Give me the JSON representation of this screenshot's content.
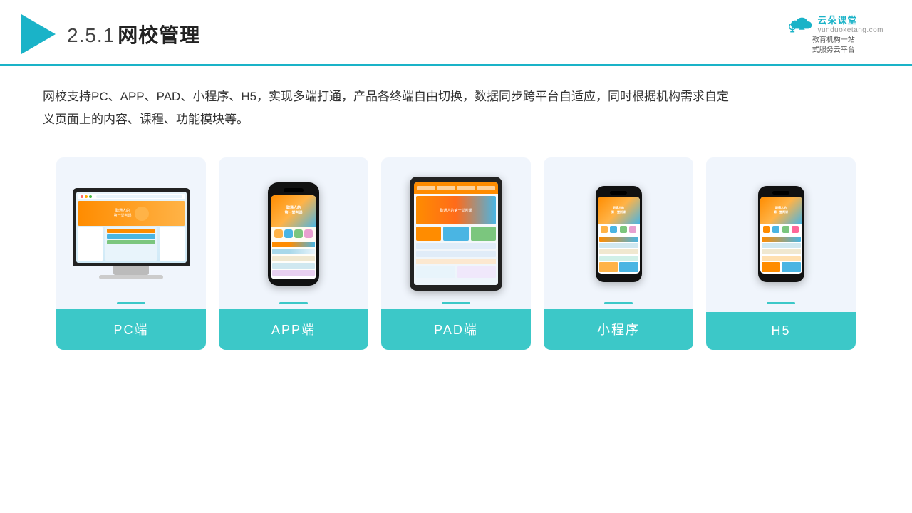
{
  "header": {
    "section": "2.5.1",
    "title": "网校管理",
    "brand": {
      "name_cn": "云朵课堂",
      "url": "yunduoketang.com",
      "slogan_line1": "教育机构一站",
      "slogan_line2": "式服务云平台"
    }
  },
  "description": {
    "text": "网校支持PC、APP、PAD、小程序、H5，实现多端打通，产品各终端自由切换，数据同步跨平台自适应，同时根据机构需求自定义页面上的内容、课程、功能模块等。"
  },
  "cards": [
    {
      "id": "pc",
      "label": "PC端"
    },
    {
      "id": "app",
      "label": "APP端"
    },
    {
      "id": "pad",
      "label": "PAD端"
    },
    {
      "id": "miniprogram",
      "label": "小程序"
    },
    {
      "id": "h5",
      "label": "H5"
    }
  ],
  "colors": {
    "accent": "#1ab3c8",
    "teal": "#3cc8c8",
    "card_bg": "#f0f5fc",
    "orange": "#ff8c00"
  }
}
